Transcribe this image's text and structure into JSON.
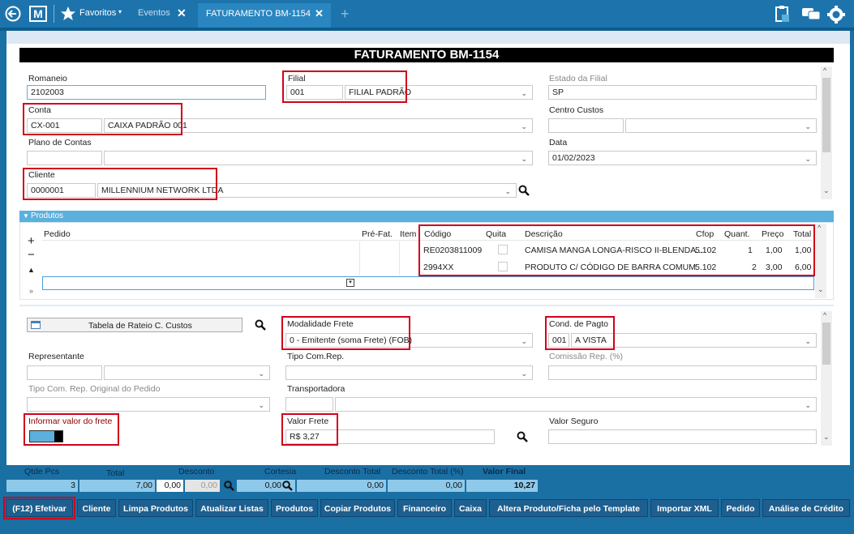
{
  "topbar": {
    "favoritos": "Favoritos",
    "eventos": "Eventos",
    "active_tab": "FATURAMENTO BM-1154"
  },
  "title": "FATURAMENTO BM-1154",
  "form1": {
    "romaneio_label": "Romaneio",
    "romaneio_value": "2102003",
    "filial_label": "Filial",
    "filial_code": "001",
    "filial_name": "FILIAL PADRÃO",
    "estado_label": "Estado da Filial",
    "estado_value": "SP",
    "conta_label": "Conta",
    "conta_code": "CX-001",
    "conta_name": "CAIXA PADRÃO 001",
    "centro_label": "Centro Custos",
    "plano_label": "Plano de Contas",
    "data_label": "Data",
    "data_value": "01/02/2023",
    "cliente_label": "Cliente",
    "cliente_code": "0000001",
    "cliente_name": "MILLENNIUM NETWORK LTDA"
  },
  "produtos": {
    "header": "Produtos",
    "cols": {
      "pedido": "Pedido",
      "prefat": "Pré-Fat.",
      "item": "Item",
      "codigo": "Código",
      "quita": "Quita",
      "descricao": "Descrição",
      "cfop": "Cfop",
      "quant": "Quant.",
      "preco": "Preço",
      "total": "Total"
    },
    "rows": [
      {
        "codigo": "RE0203811009",
        "descricao": "CAMISA MANGA LONGA-RISCO II-BLENDA...",
        "cfop": "5.102",
        "quant": "1",
        "preco": "1,00",
        "total": "1,00"
      },
      {
        "codigo": "2994XX",
        "descricao": "PRODUTO C/ CÓDIGO DE BARRA COMUM",
        "cfop": "5.102",
        "quant": "2",
        "preco": "3,00",
        "total": "6,00"
      }
    ]
  },
  "form2": {
    "rateio_button": "Tabela de Rateio C. Custos",
    "modalidade_label": "Modalidade Frete",
    "modalidade_value": "0 - Emitente (soma Frete) (FOB)",
    "cond_label": "Cond. de Pagto",
    "cond_code": "001",
    "cond_name": "A VISTA",
    "representante_label": "Representante",
    "tipo_com_label": "Tipo Com.Rep.",
    "comissao_label": "Comissão Rep. (%)",
    "tipo_com_orig_label": "Tipo Com. Rep. Original do Pedido",
    "transportadora_label": "Transportadora",
    "informar_label": "Informar valor do frete",
    "valor_frete_label": "Valor Frete",
    "valor_frete_value": "R$ 3,27",
    "valor_seguro_label": "Valor Seguro"
  },
  "totals": {
    "qtde_label": "Qtde Pcs",
    "qtde_value": "3",
    "total_label": "Total",
    "total_value": "7,00",
    "desconto_label": "Desconto",
    "desconto_value1": "0,00",
    "desconto_value2": "0,00",
    "cortesia_label": "Cortesia",
    "cortesia_value": "0,00",
    "desc_total_label": "Desconto Total",
    "desc_total_value": "0,00",
    "desc_pct_label": "Desconto Total (%)",
    "desc_pct_value": "0,00",
    "final_label": "Valor Final",
    "final_value": "10,27"
  },
  "buttons": [
    "(F12) Efetivar",
    "Cliente",
    "Limpa Produtos",
    "Atualizar Listas",
    "Produtos",
    "Copiar Produtos",
    "Financeiro",
    "Caixa",
    "Altera Produto/Ficha pelo Template",
    "Importar XML",
    "Pedido",
    "Análise de Crédito"
  ],
  "colors": {
    "accent": "#1d74ad",
    "highlight": "#d0021b",
    "footer_value": "#8fc9ea"
  }
}
